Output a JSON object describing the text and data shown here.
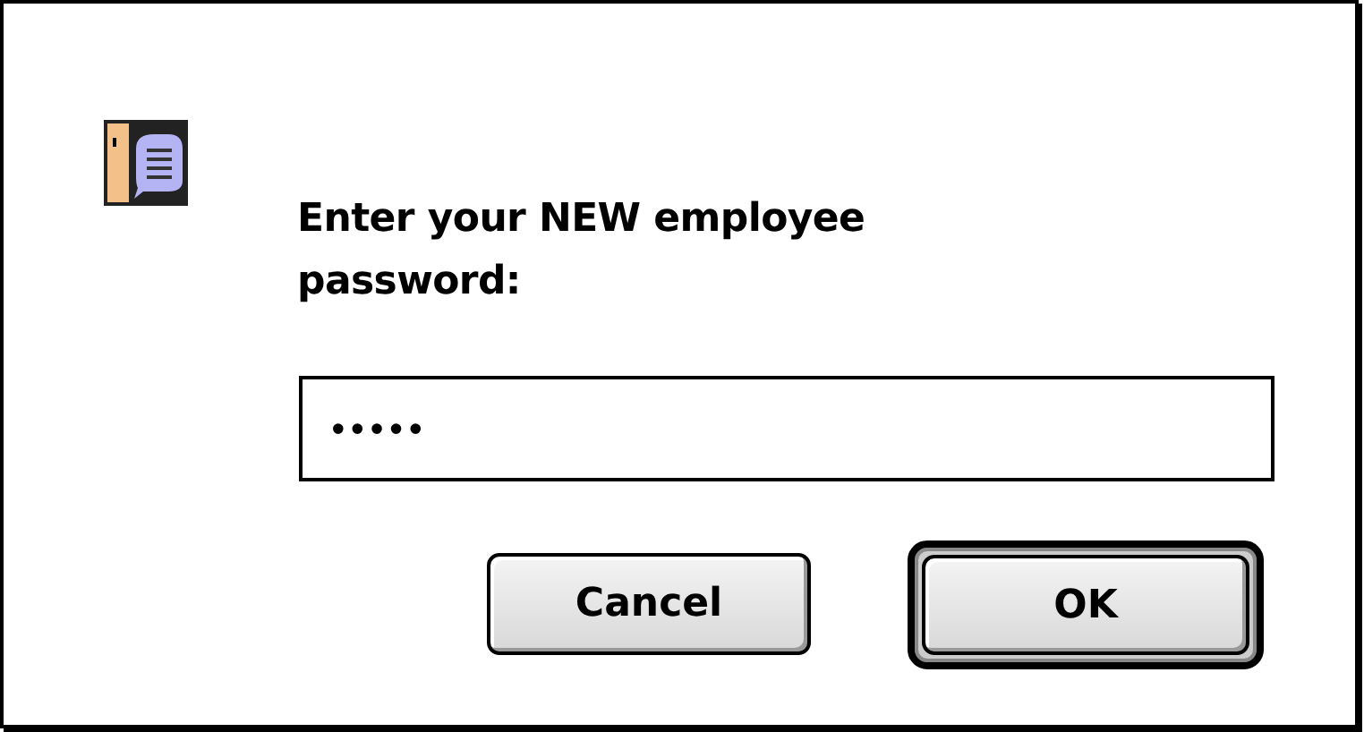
{
  "prompt": "Enter your NEW employee password:",
  "password_field": {
    "value": "•••••"
  },
  "buttons": [
    {
      "label": "Cancel",
      "default": false
    },
    {
      "label": "OK",
      "default": true
    }
  ]
}
